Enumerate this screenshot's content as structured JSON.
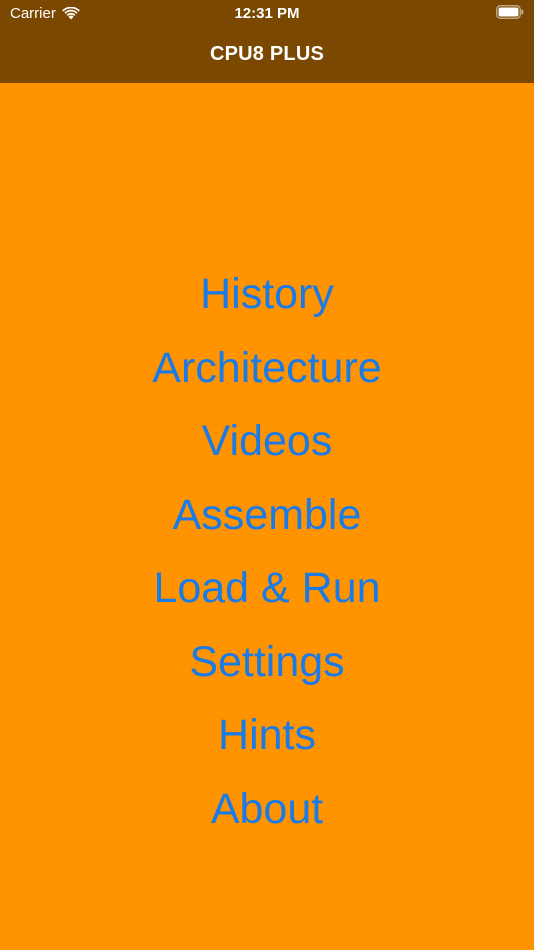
{
  "status_bar": {
    "carrier": "Carrier",
    "time": "12:31 PM",
    "icons": [
      "wifi-icon",
      "battery-icon"
    ]
  },
  "nav": {
    "title": "CPU8 PLUS"
  },
  "menu": {
    "items": [
      {
        "label": "History"
      },
      {
        "label": "Architecture"
      },
      {
        "label": "Videos"
      },
      {
        "label": "Assemble"
      },
      {
        "label": "Load & Run"
      },
      {
        "label": "Settings"
      },
      {
        "label": "Hints"
      },
      {
        "label": "About"
      }
    ]
  },
  "colors": {
    "background": "#FF9300",
    "nav_bar": "#7A4800",
    "link": "#1B7BE6",
    "nav_text": "#FFFFFF"
  }
}
